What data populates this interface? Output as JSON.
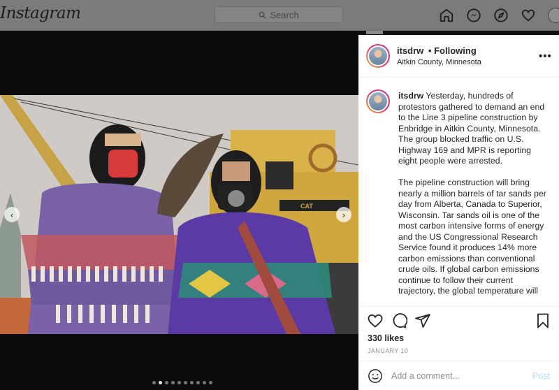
{
  "nav": {
    "logo": "Instagram",
    "search_placeholder": "Search",
    "icons": [
      "home-icon",
      "messenger-icon",
      "explore-icon",
      "heart-icon",
      "profile-avatar"
    ]
  },
  "post": {
    "username": "itsdrw",
    "separator": "•",
    "follow_status": "Following",
    "location": "Aitkin County, Minnesota",
    "more": "•••",
    "caption_user": "itsdrw",
    "caption_p1": "Yesterday, hundreds of protestors gathered to demand an end to the Line 3 pipeline construction by Enbridge in Aitkin County, Minnesota. The group blocked traffic on U.S. Highway 169 and MPR is reporting eight people were arrested.",
    "caption_p2": "The pipeline construction will bring nearly a million barrels of tar sands per day from Alberta, Canada to Superior, Wisconsin. Tar sands oil is one of the most carbon intensive forms of energy and the US Congressional Research Service found it produces 14% more carbon emissions than conventional crude oils. If global carbon emissions continue to follow their current trajectory, the global temperature will",
    "likes": "330 likes",
    "date": "JANUARY 10",
    "comment_placeholder": "Add a comment...",
    "post_label": "Post",
    "carousel": {
      "count": 10,
      "active_index": 1
    }
  },
  "colors": {
    "accent": "#0095f6",
    "post_disabled": "#b2dffc",
    "text": "#262626",
    "muted": "#8e8e8e"
  }
}
